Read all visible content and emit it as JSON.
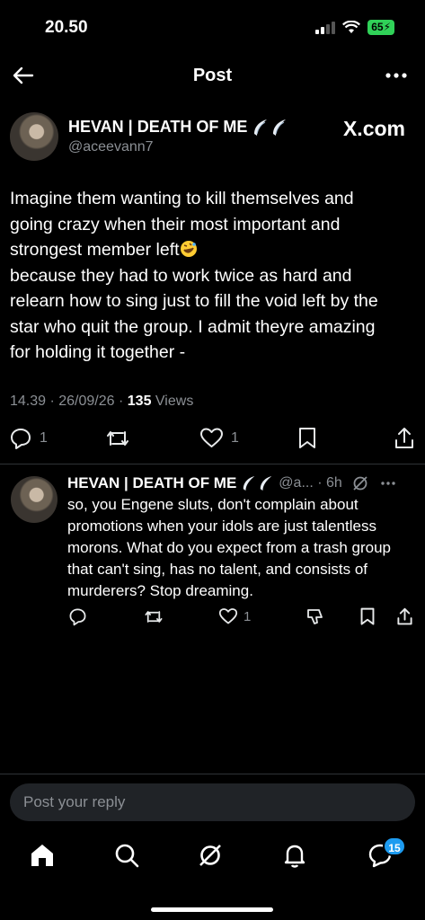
{
  "status_bar": {
    "time": "20.50",
    "battery": "65"
  },
  "nav": {
    "title": "Post"
  },
  "post": {
    "author_name": "HEVAN | DEATH OF ME",
    "handle": "@aceevann7",
    "watermark": "X.com",
    "text_lines": [
      "Imagine them wanting to kill themselves and",
      "going crazy when their most important and",
      "strongest member left",
      "because they had to work twice as hard and",
      "relearn how to sing just to fill the void left by the",
      "star who quit the group. I admit theyre amazing",
      "for holding it together -"
    ],
    "timestamp": "14.39 · 26/09/26 ·",
    "views_count": "135",
    "views_label": "Views",
    "reply_count": "1",
    "like_count": "1"
  },
  "reply": {
    "author_name": "HEVAN | DEATH OF ME",
    "handle_time": "@a... · 6h",
    "text_lines": [
      "so, you Engene sluts, don't complain about",
      "promotions when your idols are just talentless",
      "morons. What do you expect from a trash group",
      "that can't sing, has no talent, and consists of",
      "murderers? Stop dreaming."
    ],
    "like_count": "1"
  },
  "composer": {
    "placeholder": "Post your reply"
  },
  "tabbar": {
    "messages_badge": "15"
  },
  "colors": {
    "background": "#000000",
    "secondary_text": "#8b8f94",
    "accent": "#1d9bf0",
    "divider": "#2f3336"
  }
}
